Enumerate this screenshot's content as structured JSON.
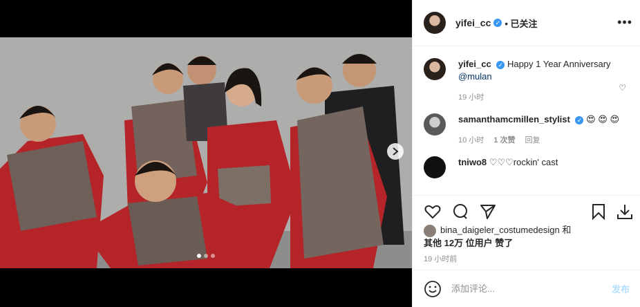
{
  "header": {
    "username": "yifei_cc",
    "follow_status": "• 已关注",
    "more": "•••"
  },
  "caption": {
    "username": "yifei_cc",
    "text": "Happy 1 Year Anniversary",
    "mention": "@mulan",
    "time": "19 小时"
  },
  "comments": [
    {
      "username": "samanthamcmillen_stylist",
      "text": "😍 😍 😍",
      "time": "10 小时",
      "likes": "1 次赞",
      "reply": "回复"
    },
    {
      "username": "tniwo8",
      "text": "♡♡♡rockin' cast"
    }
  ],
  "likes": {
    "user": "bina_daigeler_costumedesign",
    "suffix": " 和",
    "line2": "其他 12万 位用户 赞了"
  },
  "post_time": "19 小时前",
  "composer": {
    "placeholder": "添加评论...",
    "post_label": "发布"
  },
  "carousel": {
    "active_index": 1,
    "count": 3
  },
  "colors": {
    "verified": "#3897f0",
    "post_disabled": "#b2dffc",
    "armor_red": "#b52428"
  }
}
